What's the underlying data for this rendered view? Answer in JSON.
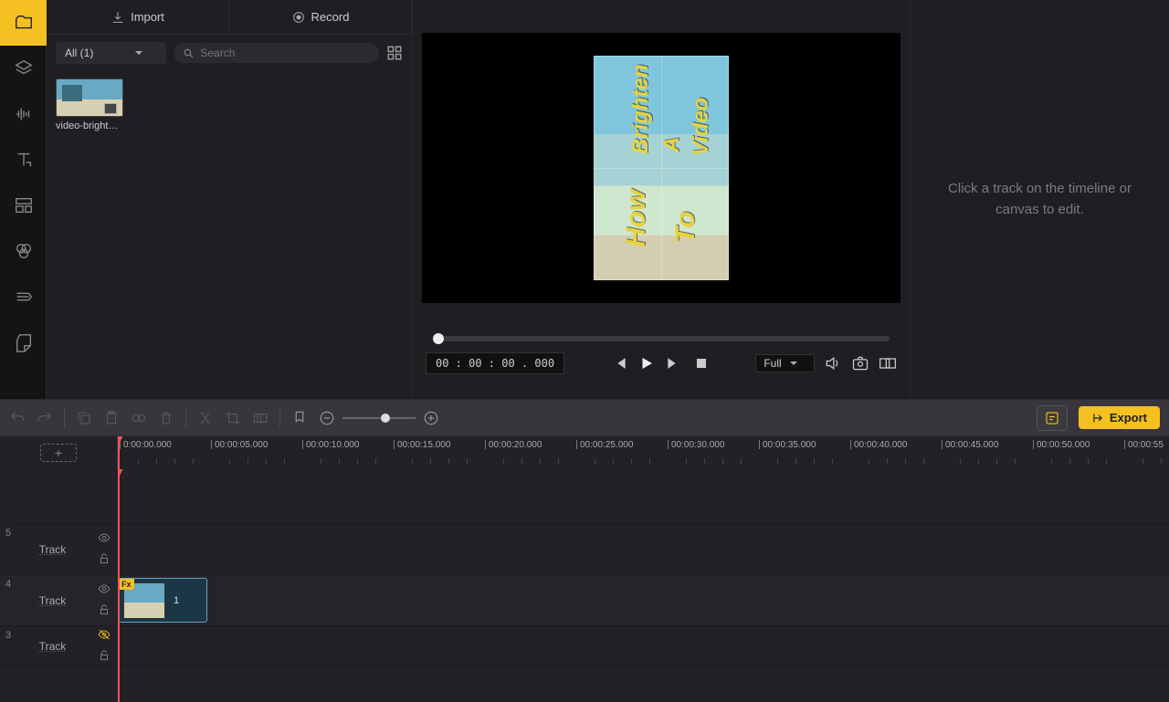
{
  "nav": {
    "active": 0
  },
  "media": {
    "tabs": {
      "import": "Import",
      "record": "Record"
    },
    "filter": "All (1)",
    "search_placeholder": "Search",
    "items": [
      {
        "label": "video-bright…"
      }
    ]
  },
  "preview": {
    "text": {
      "how": "How",
      "to": "To",
      "brighten": "Brighten",
      "a": "A",
      "video": "Video"
    },
    "timecode": "00 : 00 : 00 . 000",
    "zoom": "Full"
  },
  "right_panel": {
    "hint": "Click a track on the timeline or canvas to edit."
  },
  "toolbar": {
    "export": "Export"
  },
  "timeline": {
    "ticks": [
      "0:00:00.000",
      "00:00:05.000",
      "00:00:10.000",
      "00:00:15.000",
      "00:00:20.000",
      "00:00:25.000",
      "00:00:30.000",
      "00:00:35.000",
      "00:00:40.000",
      "00:00:45.000",
      "00:00:50.000",
      "00:00:55"
    ],
    "tracks": [
      {
        "num": "5",
        "label": "Track",
        "hidden": false
      },
      {
        "num": "4",
        "label": "Track",
        "hidden": false,
        "clip": {
          "fx": "Fx",
          "index": "1",
          "left": 0,
          "width": 98
        }
      },
      {
        "num": "3",
        "label": "Track",
        "hidden": true
      }
    ]
  }
}
